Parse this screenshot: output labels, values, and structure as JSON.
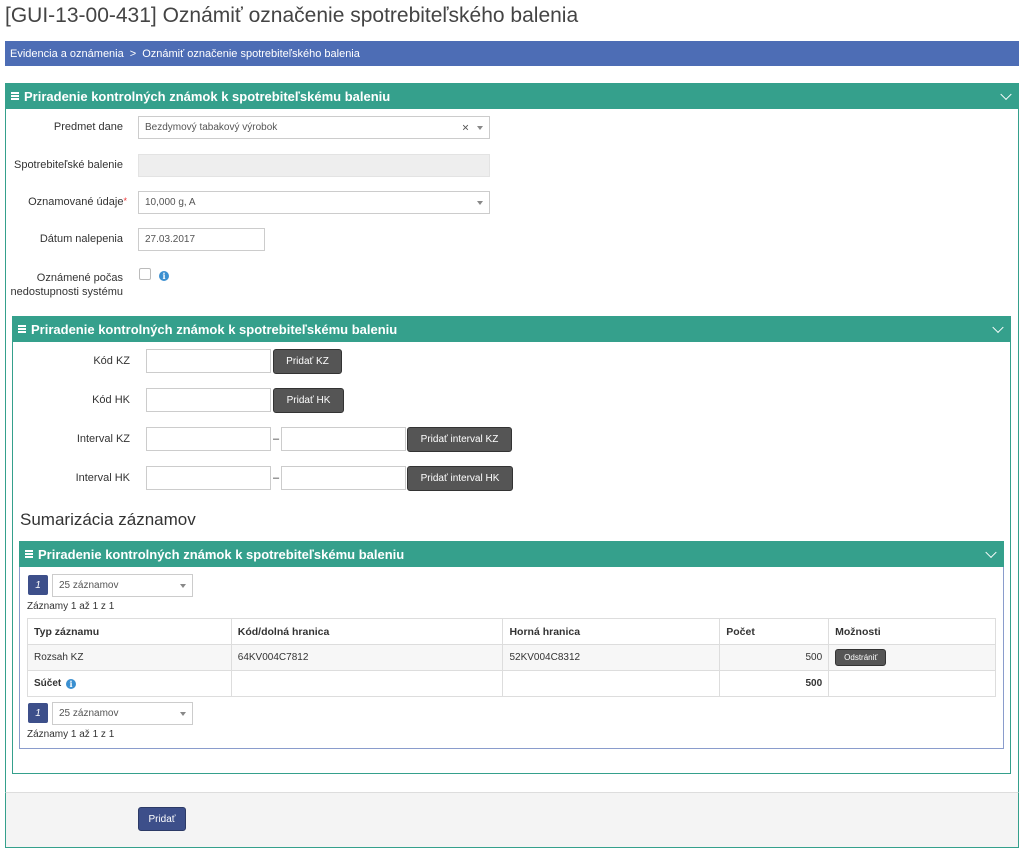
{
  "page": {
    "title": "[GUI-13-00-431] Oznámiť označenie spotrebiteľského balenia"
  },
  "breadcrumb": {
    "items": [
      "Evidencia a oznámenia",
      "Oznámiť označenie spotrebiteľského balenia"
    ],
    "separator": ">"
  },
  "panel_main": {
    "title": "Priradenie kontrolných známok k spotrebiteľskému baleniu"
  },
  "form": {
    "predmet_dane": {
      "label": "Predmet dane",
      "value": "Bezdymový tabakový výrobok"
    },
    "spotrebitelske_balenie": {
      "label": "Spotrebiteľské balenie",
      "value": ""
    },
    "oznamovane_udaje": {
      "label": "Oznamované údaje",
      "required_mark": "*",
      "value": "10,000 g, A"
    },
    "datum_nalepenia": {
      "label": "Dátum nalepenia",
      "value": "27.03.2017"
    },
    "oznamene_pocas": {
      "label_line1": "Oznámené počas",
      "label_line2": "nedostupnosti systému",
      "checked": false
    }
  },
  "panel_codes": {
    "title": "Priradenie kontrolných známok k spotrebiteľskému baleniu"
  },
  "codes": {
    "kod_kz": {
      "label": "Kód KZ",
      "button": "Pridať KZ"
    },
    "kod_hk": {
      "label": "Kód HK",
      "button": "Pridať HK"
    },
    "interval_kz": {
      "label": "Interval KZ",
      "dash": "–",
      "button": "Pridať interval KZ"
    },
    "interval_hk": {
      "label": "Interval HK",
      "dash": "–",
      "button": "Pridať interval HK"
    }
  },
  "summary": {
    "heading": "Sumarizácia záznamov",
    "panel_title": "Priradenie kontrolných známok k spotrebiteľskému baleniu",
    "pager": {
      "page": "1",
      "page_size": "25 záznamov",
      "records_text": "Záznamy 1 až 1 z 1"
    },
    "columns": [
      "Typ záznamu",
      "Kód/dolná hranica",
      "Horná hranica",
      "Počet",
      "Možnosti"
    ],
    "rows": [
      {
        "typ": "Rozsah KZ",
        "kod": "64KV004C7812",
        "horna": "52KV004C8312",
        "pocet": "500",
        "action": "Odstrániť"
      }
    ],
    "total": {
      "label": "Súčet",
      "pocet": "500"
    }
  },
  "footer": {
    "submit": "Pridať"
  },
  "colors": {
    "teal": "#35a08c",
    "breadcrumb_blue": "#4d6db5",
    "primary": "#3d4f8a"
  }
}
